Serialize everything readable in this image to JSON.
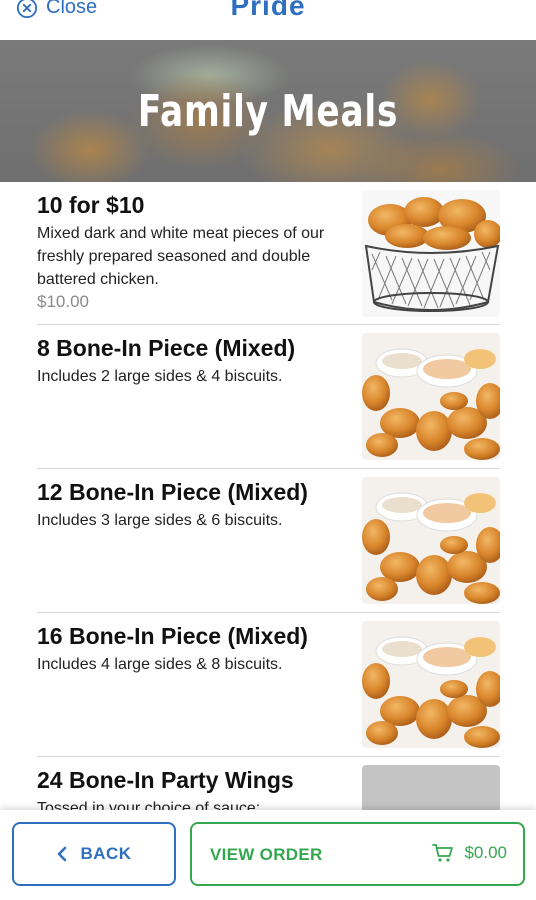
{
  "topbar": {
    "close_label": "Close",
    "brand": "Pride"
  },
  "hero": {
    "title": "Family Meals"
  },
  "items": [
    {
      "name": "10 for $10",
      "description": "Mixed dark and white meat pieces of our freshly prepared seasoned and double battered chicken.",
      "price": "$10.00",
      "thumbnail": "basket-of-fried-chicken"
    },
    {
      "name": "8 Bone-In Piece (Mixed)",
      "description": "Includes 2 large sides & 4 biscuits.",
      "price": "",
      "thumbnail": "fried-chicken-with-sides"
    },
    {
      "name": "12 Bone-In Piece (Mixed)",
      "description": "Includes 3 large sides & 6 biscuits.",
      "price": "",
      "thumbnail": "fried-chicken-with-sides"
    },
    {
      "name": "16 Bone-In Piece (Mixed)",
      "description": "Includes 4 large sides & 8 biscuits.",
      "price": "",
      "thumbnail": "fried-chicken-with-sides"
    },
    {
      "name": "24 Bone-In Party Wings",
      "description": "Tossed in your choice of sauce:",
      "price": "",
      "thumbnail": "placeholder"
    }
  ],
  "bottombar": {
    "back_label": "BACK",
    "view_order_label": "VIEW ORDER",
    "order_total": "$0.00"
  },
  "colors": {
    "accent_blue": "#2f6fc0",
    "accent_green": "#35a84f",
    "price_gray": "#8a8a8a"
  },
  "icons": {
    "close": "close-circle-icon",
    "back": "chevron-left-icon",
    "cart": "cart-icon"
  }
}
